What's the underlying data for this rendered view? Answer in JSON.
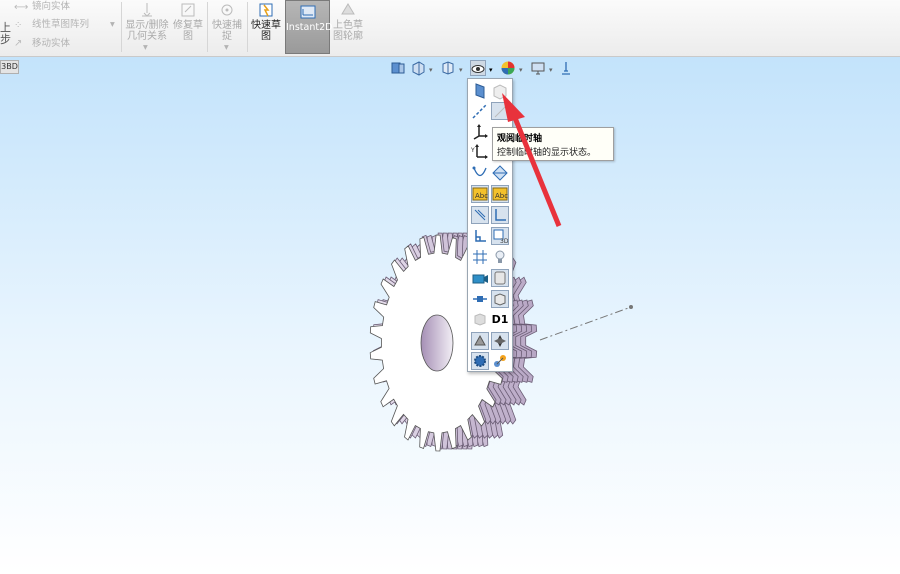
{
  "ribbon": {
    "left_partial": "上 步",
    "mirror_entities": "镜向实体",
    "linear_pattern": "线性草图阵列",
    "move_entities": "移动实体",
    "display_delete": "显示/删除 几何关系",
    "repair_sketch": "修复草 图",
    "quick_snaps": "快速捕 捉",
    "rapid_sketch": "快速草 图",
    "instant2d": "Instant2D",
    "shaded_sketch": "上色草 图轮廓"
  },
  "viewport": {
    "tab_3d": "3BD"
  },
  "menu": {
    "d1_label": "D1"
  },
  "tooltip": {
    "title": "观阅临时轴",
    "desc": "控制临时轴的显示状态。"
  },
  "colors": {
    "arrow": "#e8323c",
    "gear_side": "#c8b8d2",
    "viewport_top": "#c3e3fb"
  }
}
